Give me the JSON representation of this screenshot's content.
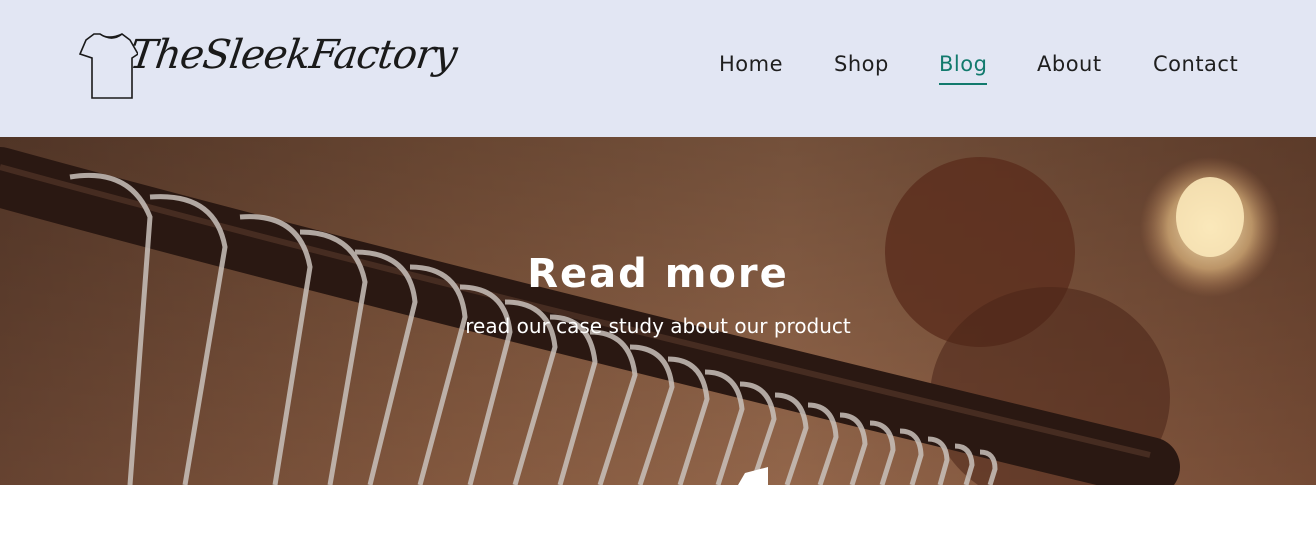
{
  "brand": {
    "name": "TheSleekFactory"
  },
  "nav": {
    "items": [
      {
        "label": "Home"
      },
      {
        "label": "Shop"
      },
      {
        "label": "Blog",
        "active": true
      },
      {
        "label": "About"
      },
      {
        "label": "Contact"
      }
    ]
  },
  "hero": {
    "title": "Read more",
    "subtitle": "read our case study about our product"
  },
  "colors": {
    "header_bg": "#e2e6f3",
    "accent": "#127a6d",
    "text": "#1f1f1f"
  }
}
